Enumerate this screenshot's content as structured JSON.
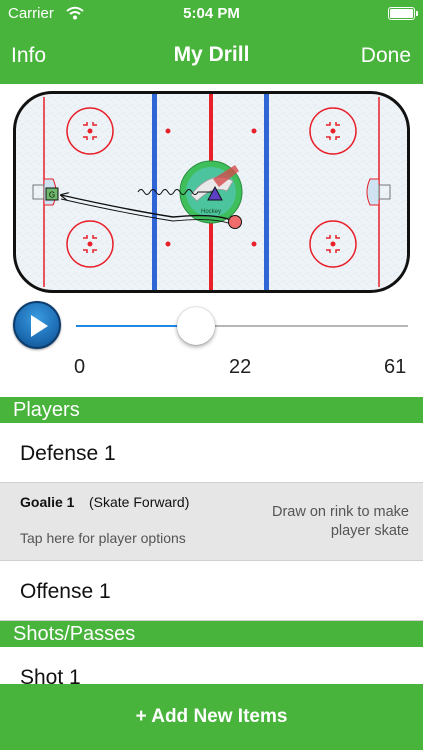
{
  "status_bar": {
    "carrier": "Carrier",
    "time": "5:04 PM"
  },
  "nav": {
    "left": "Info",
    "title": "My Drill",
    "right": "Done"
  },
  "rink": {
    "ice_color": "#eef3f7",
    "red_line_color": "#e8202a",
    "blue_line_color": "#2f66d6",
    "goalie_marker": "G",
    "center_logo_text": "Hockey"
  },
  "timeline": {
    "min": "0",
    "current": "22",
    "max": "61",
    "progress": 0.361
  },
  "sections": [
    {
      "header": "Players",
      "items": [
        {
          "label": "Defense 1"
        },
        {
          "name": "Goalie 1",
          "action": "(Skate Forward)",
          "options": "Tap here for player options",
          "hint": "Draw on rink to make player skate"
        },
        {
          "label": "Offense 1"
        }
      ]
    },
    {
      "header": "Shots/Passes",
      "items": [
        {
          "label": "Shot 1"
        }
      ]
    }
  ],
  "footer": {
    "add_label": "+ Add New Items"
  },
  "colors": {
    "accent": "#48b43c",
    "play_button": "#1d6db4",
    "slider_fill": "#1e88e5"
  }
}
